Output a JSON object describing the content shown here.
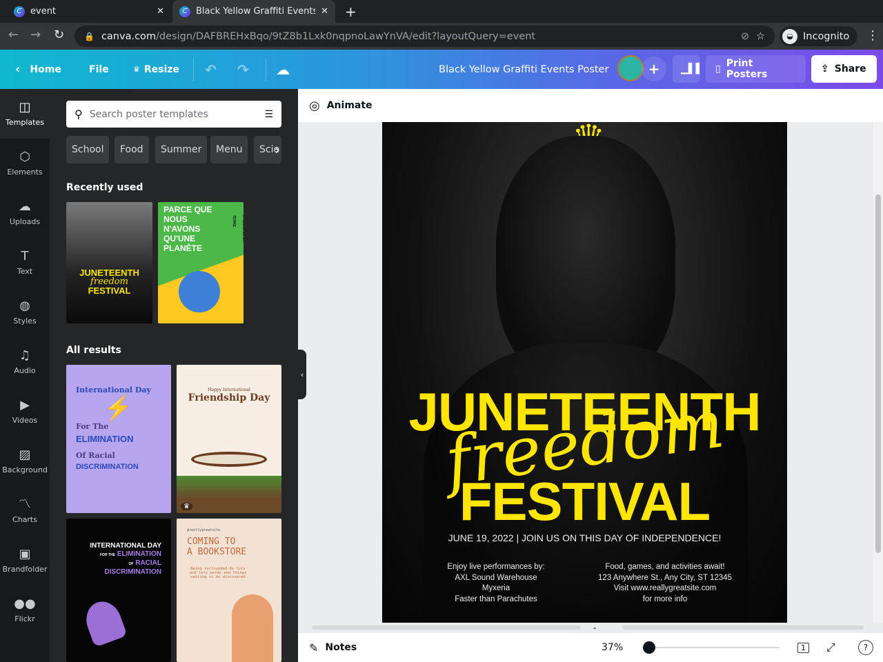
{
  "browser": {
    "tabs": [
      {
        "title": "event"
      },
      {
        "title": "Black Yellow Graffiti Events"
      }
    ],
    "url_host": "canva.com",
    "url_path": "/design/DAFBREHxBqo/9tZ8b1Lxk0nqpnoLawYnVA/edit?layoutQuery=event",
    "profile": "Incognito"
  },
  "header": {
    "home": "Home",
    "file": "File",
    "resize": "Resize",
    "doc_title": "Black Yellow Graffiti Events Poster",
    "print": "Print Posters",
    "share": "Share"
  },
  "rail": [
    {
      "label": "Templates",
      "icon": "◫"
    },
    {
      "label": "Elements",
      "icon": "⬡"
    },
    {
      "label": "Uploads",
      "icon": "☁"
    },
    {
      "label": "Text",
      "icon": "T"
    },
    {
      "label": "Styles",
      "icon": "◍"
    },
    {
      "label": "Audio",
      "icon": "♫"
    },
    {
      "label": "Videos",
      "icon": "▶"
    },
    {
      "label": "Background",
      "icon": "▨"
    },
    {
      "label": "Charts",
      "icon": "〽"
    },
    {
      "label": "Brandfolder",
      "icon": "▣"
    },
    {
      "label": "Flickr",
      "icon": "●●"
    }
  ],
  "panel": {
    "search_placeholder": "Search poster templates",
    "chips": [
      "School",
      "Food",
      "Summer",
      "Menu",
      "Scie"
    ],
    "recent_title": "Recently used",
    "all_title": "All results",
    "recent": [
      {
        "lines": [
          "JUNETEENTH",
          "freedom",
          "FESTIVAL"
        ]
      },
      {
        "lines": [
          "PARCE QUE",
          "NOUS",
          "N'AVONS",
          "QU'UNE",
          "PLANÈTE"
        ],
        "side": "L'HEURE DE LA TERRE"
      }
    ],
    "results": [
      {
        "lines": [
          "International Day",
          "For The",
          "ELIMINATION",
          "Of Racial",
          "DISCRIMINATION"
        ]
      },
      {
        "lines": [
          "Happy International",
          "Friendship Day"
        ]
      },
      {
        "lines": [
          "INTERNATIONAL DAY",
          "FOR THE",
          "ELIMINATION",
          "OF",
          "RACIAL",
          "DISCRIMINATION"
        ]
      },
      {
        "lines": [
          "@reallygreatsite",
          "COMING TO",
          "A BOOKSTORE",
          "Being surrounded by lots and lots words and things waiting to be discovered"
        ]
      }
    ]
  },
  "editor": {
    "animate": "Animate",
    "notes": "Notes",
    "zoom": "37%",
    "page": "1"
  },
  "poster": {
    "line1": "JUNETEENTH",
    "script": "freedom",
    "line2": "FESTIVAL",
    "date_line": "JUNE 19, 2022 | JOIN US ON THIS DAY OF INDEPENDENCE!",
    "left": [
      "Enjoy live performances by:",
      "AXL Sound Warehouse",
      "Myxeria",
      "Faster than Parachutes"
    ],
    "right": [
      "Food, games, and activities await!",
      "123 Anywhere St., Any City, ST 12345",
      "Visit www.reallygreatsite.com",
      "for more info"
    ]
  },
  "colors": {
    "accent_yellow": "#ffe600",
    "panel": "#252627",
    "rail": "#18191b"
  }
}
